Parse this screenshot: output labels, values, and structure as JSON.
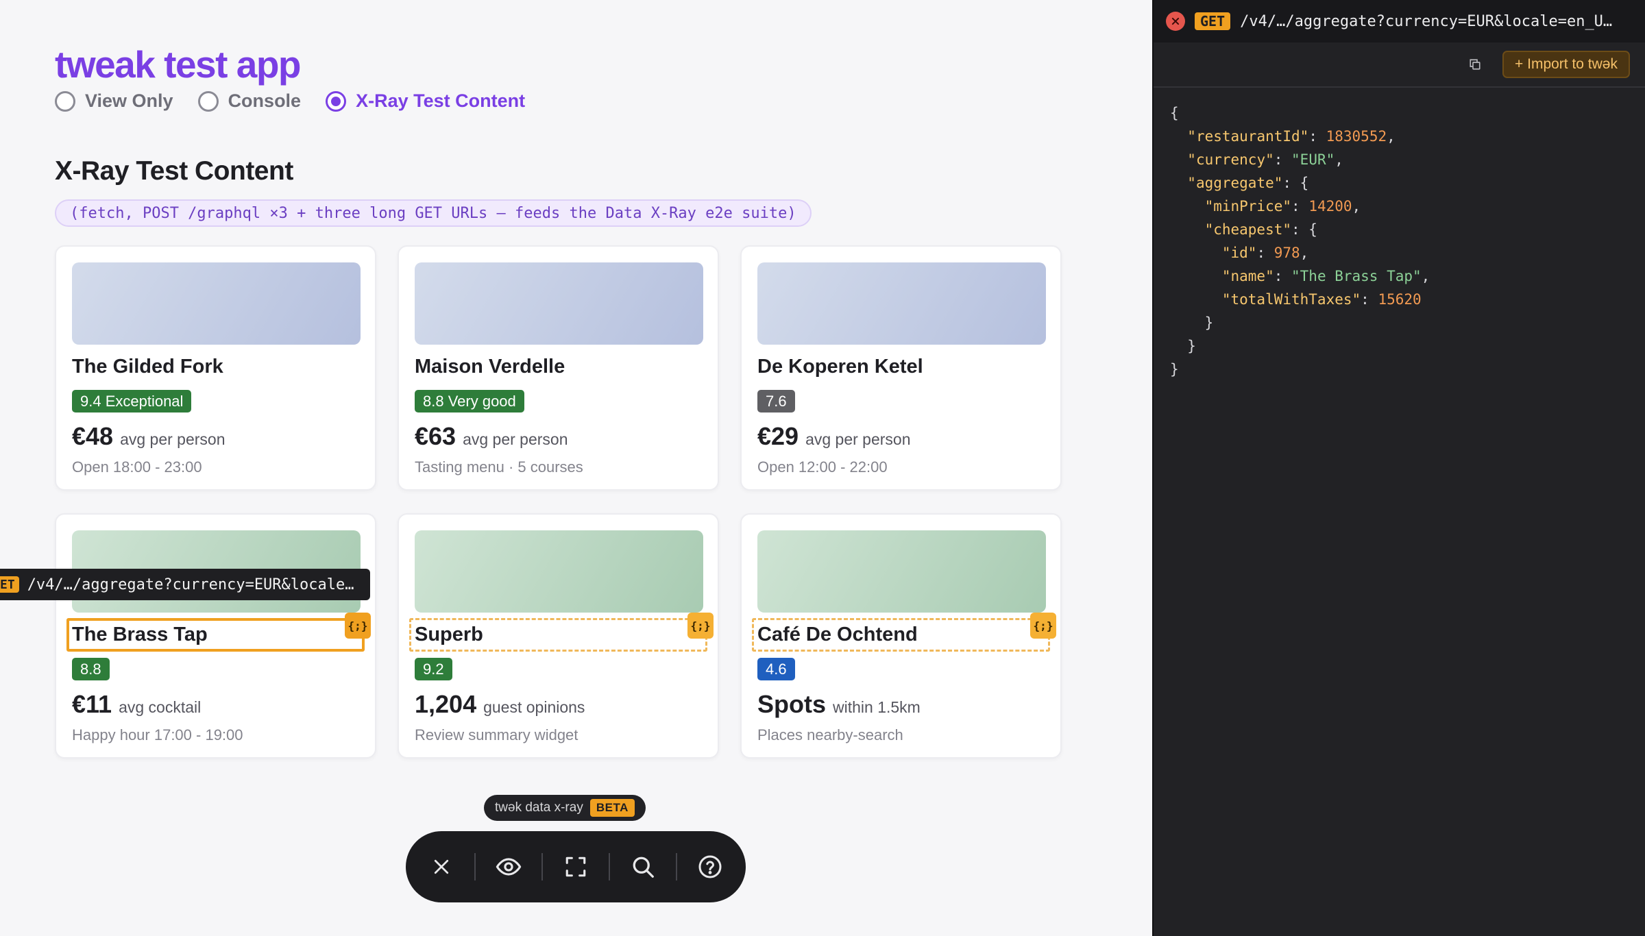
{
  "app": {
    "title": "tweak test app",
    "modes": [
      "View Only",
      "Console",
      "X-Ray Test Content"
    ],
    "active_mode": "X-Ray Test Content"
  },
  "section": {
    "title": "X-Ray Test Content",
    "note": "(fetch, POST /graphql ×3 + three long GET URLs — feeds the Data X-Ray e2e suite)"
  },
  "cards": [
    {
      "name": "The Gilded Fork",
      "badge": "9.4 Exceptional",
      "price": "€48",
      "unit": "avg per person",
      "meta": "Open 18:00 - 23:00"
    },
    {
      "name": "Maison Verdelle",
      "badge": "8.8 Very good",
      "price": "€63",
      "unit": "avg per person",
      "meta": "Tasting menu · 5 courses"
    },
    {
      "name": "De Koperen Ketel",
      "badge": "7.6",
      "price": "€29",
      "unit": "avg per person",
      "meta": "Open 12:00 - 22:00"
    },
    {
      "name": "The Brass Tap",
      "badge": "8.8",
      "price": "€11",
      "unit": "avg cocktail",
      "meta": "Happy hour 17:00 - 19:00"
    },
    {
      "name": "Superb",
      "badge": "9.2",
      "price": "1,204",
      "unit": "guest opinions",
      "meta": "Review summary widget"
    },
    {
      "name": "Café De Ochtend",
      "badge": "4.6",
      "price": "Spots",
      "unit": "within 1.5km",
      "meta": "Places nearby-search"
    }
  ],
  "colors": {
    "accent": "#7a3fe4",
    "badge_green": "#2e7d3a",
    "badge_gray": "#5f5f63",
    "badge_blue": "#1f5fbf",
    "xray_orange": "#f0a020"
  },
  "xray": {
    "tag_icon": "{;}",
    "tooltip_method": "ET",
    "tooltip_url": "/v4/…/aggregate?currency=EUR&locale…"
  },
  "overlay": {
    "label": "twək data x-ray",
    "beta": "BETA",
    "tools": [
      "close-icon",
      "eye-icon",
      "fullscreen-icon",
      "search-icon",
      "help-icon"
    ]
  },
  "panel": {
    "method": "GET",
    "url": "/v4/…/aggregate?currency=EUR&locale=en_U…",
    "import_label": "+ Import to twək",
    "json": {
      "restaurantId": "1830552",
      "currency": "\"EUR\"",
      "minPrice": "14200",
      "id": "978",
      "name": "\"The Brass Tap\"",
      "totalWithTaxes": "15620"
    }
  }
}
